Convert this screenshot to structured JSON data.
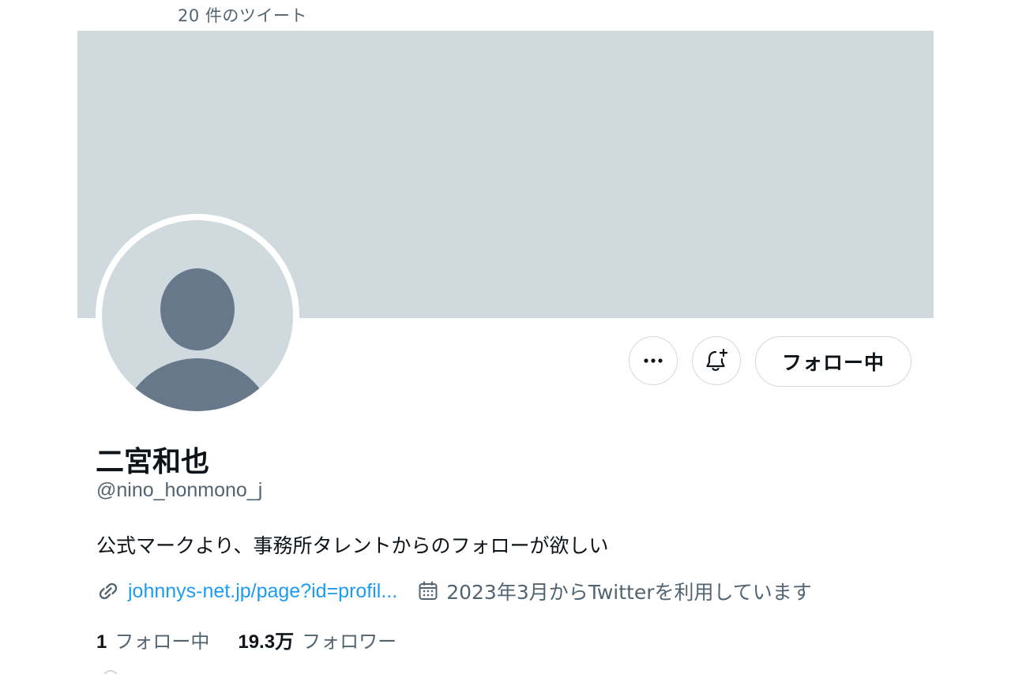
{
  "header": {
    "tweet_count": "20 件のツイート"
  },
  "actions": {
    "more_icon": "more-horizontal-icon",
    "notify_icon": "bell-plus-icon",
    "follow_label": "フォロー中"
  },
  "profile": {
    "display_name": "二宮和也",
    "handle": "@nino_honmono_j",
    "bio": "公式マークより、事務所タレントからのフォローが欲しい",
    "link_icon": "link-icon",
    "link_text": "johnnys-net.jp/page?id=profil...",
    "calendar_icon": "calendar-icon",
    "joined_text": "2023年3月からTwitterを利用しています"
  },
  "stats": {
    "following_count": "1",
    "following_label": "フォロー中",
    "followers_count": "19.3万",
    "followers_label": "フォロワー"
  },
  "colors": {
    "banner": "#cfd9de",
    "avatar_figure": "#66788a",
    "link": "#1d9bf0",
    "secondary_text": "#536471",
    "primary_text": "#0f1419"
  }
}
